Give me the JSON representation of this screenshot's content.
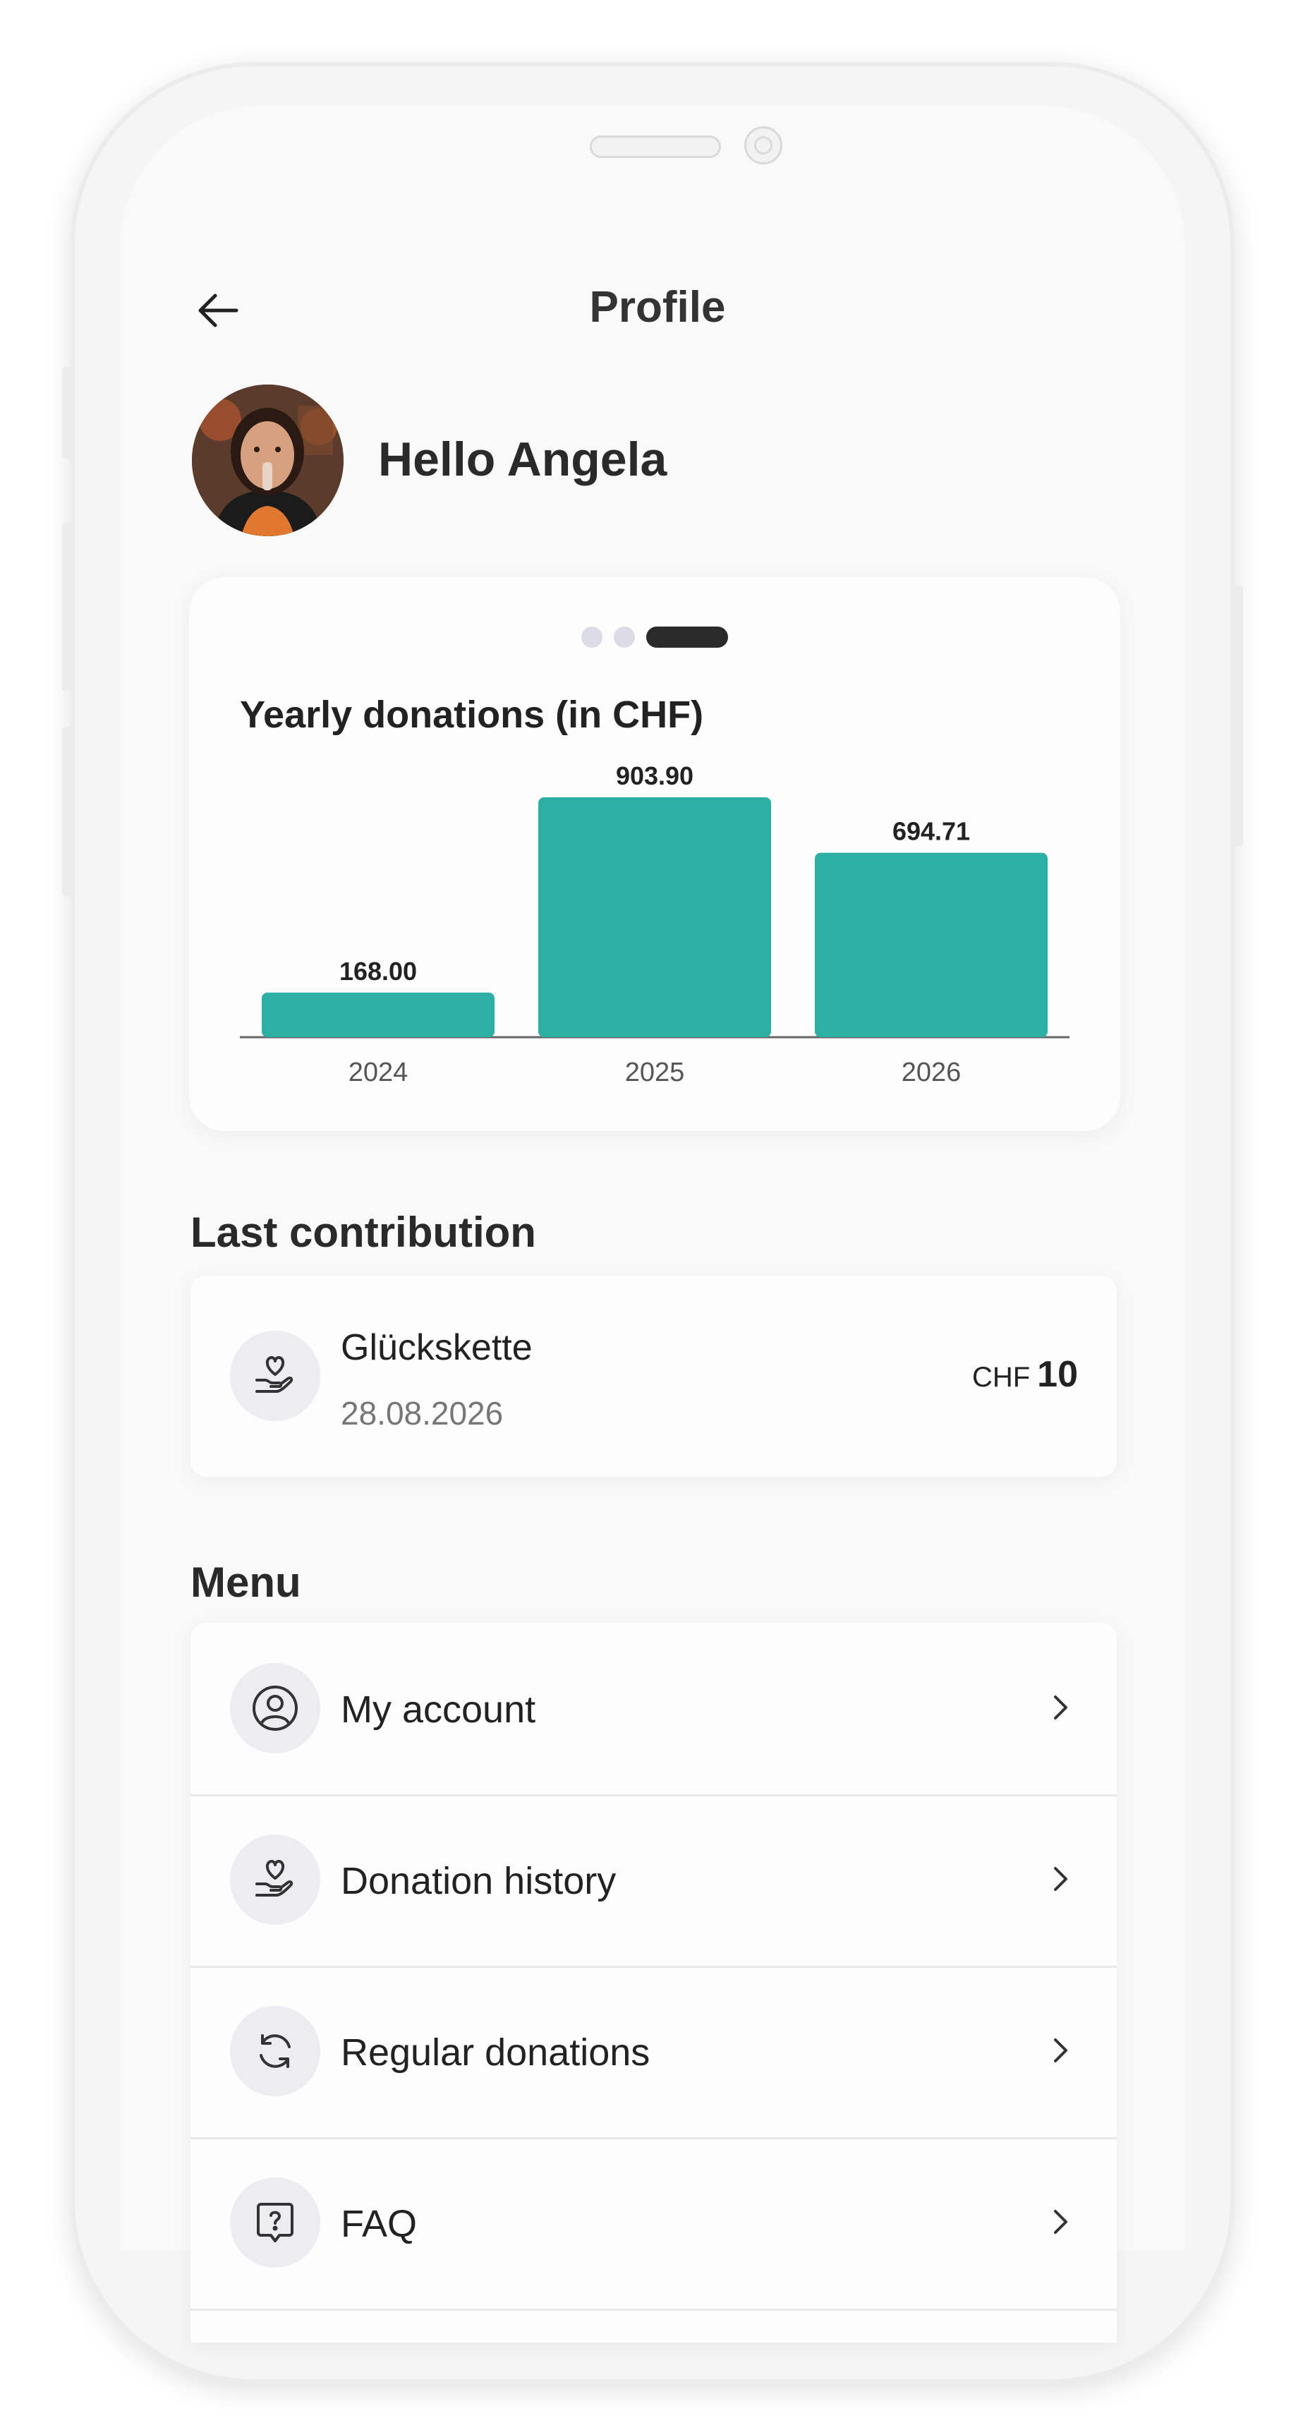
{
  "header": {
    "title": "Profile"
  },
  "user": {
    "greeting": "Hello Angela"
  },
  "chart_data": {
    "type": "bar",
    "title": "Yearly donations (in CHF)",
    "categories": [
      "2024",
      "2025",
      "2026"
    ],
    "values": [
      168.0,
      903.9,
      694.71
    ],
    "value_labels": [
      "168.00",
      "903.90",
      "694.71"
    ],
    "ylim": [
      0,
      1000
    ],
    "bar_color": "#2db0a4",
    "grid": false,
    "pager": {
      "count": 3,
      "active": 3
    }
  },
  "last_contribution": {
    "section_title": "Last contribution",
    "name": "Glückskette",
    "date": "28.08.2026",
    "currency": "CHF",
    "amount": "10",
    "icon": "heart-hand-icon"
  },
  "menu": {
    "section_title": "Menu",
    "items": [
      {
        "label": "My account",
        "icon": "user-circle-icon"
      },
      {
        "label": "Donation history",
        "icon": "heart-hand-icon"
      },
      {
        "label": "Regular donations",
        "icon": "refresh-icon"
      },
      {
        "label": "FAQ",
        "icon": "question-bubble-icon"
      }
    ]
  },
  "colors": {
    "accent": "#2db0a4",
    "background": "#f9f9f9",
    "icon_bg": "#ededf1"
  }
}
